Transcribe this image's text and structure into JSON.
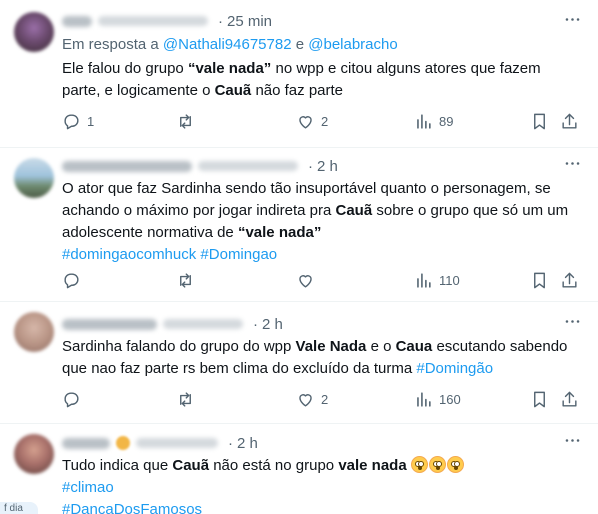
{
  "tweets": [
    {
      "time": "25 min",
      "reply_prefix": "Em resposta a",
      "reply_handle_1": "@Nathali94675782",
      "reply_and": "e",
      "reply_handle_2": "@belabracho",
      "text": {
        "p1": "Ele falou do grupo ",
        "b1": "“vale nada”",
        "p2": " no wpp e citou alguns atores que fazem parte, e logicamente o ",
        "b2": "Cauã",
        "p3": " não faz parte"
      },
      "replies": "1",
      "likes": "2",
      "views": "89"
    },
    {
      "time": "2 h",
      "text": {
        "p1": "O ator que faz Sardinha sendo tão insuportável quanto o personagem, se achando o máximo por jogar indireta pra ",
        "b1": "Cauã",
        "p2": " sobre o grupo que só um um adolescente normativa de ",
        "b2": "“vale nada”"
      },
      "hashtag_1": "#domingaocomhuck",
      "hashtag_2": "#Domingao",
      "views": "110"
    },
    {
      "time": "2 h",
      "text": {
        "p1": "Sardinha falando do grupo do wpp ",
        "b1": "Vale Nada",
        "p2": " e o ",
        "b2": "Caua",
        "p3": " escutando sabendo que nao faz parte rs bem clima do excluído da turma "
      },
      "hashtag_1": "#Domingão",
      "views": "160",
      "likes": "2"
    },
    {
      "time": "2 h",
      "text": {
        "p1": "Tudo indica que ",
        "b1": "Cauã",
        "p2": " não está no grupo ",
        "b2": "vale nada"
      },
      "hashtag_1": "#climao",
      "hashtag_2": "#DancaDosFamosos"
    }
  ],
  "corner_label": "f dia",
  "icons": [
    "more-icon",
    "reply-icon",
    "retweet-icon",
    "like-icon",
    "views-icon",
    "bookmark-icon",
    "share-icon",
    "flushed-face-emoji"
  ],
  "colors": {
    "link": "#1d9bf0",
    "secondary": "#536471",
    "text": "#0f1419",
    "divider": "#eff3f4"
  }
}
